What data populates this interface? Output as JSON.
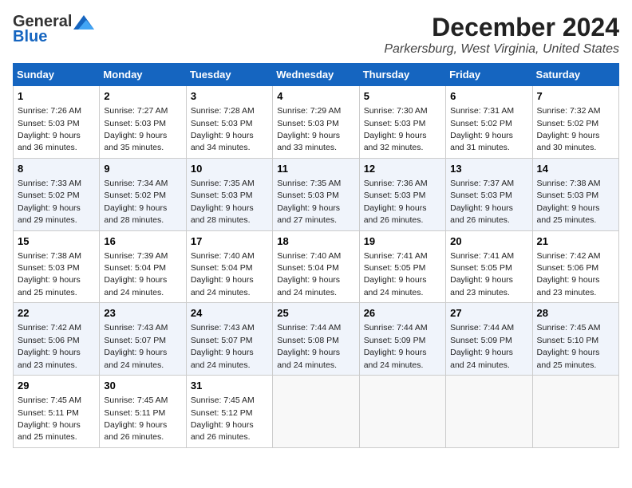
{
  "logo": {
    "general": "General",
    "blue": "Blue"
  },
  "title": "December 2024",
  "location": "Parkersburg, West Virginia, United States",
  "days_header": [
    "Sunday",
    "Monday",
    "Tuesday",
    "Wednesday",
    "Thursday",
    "Friday",
    "Saturday"
  ],
  "weeks": [
    [
      {
        "day": "1",
        "lines": [
          "Sunrise: 7:26 AM",
          "Sunset: 5:03 PM",
          "Daylight: 9 hours",
          "and 36 minutes."
        ]
      },
      {
        "day": "2",
        "lines": [
          "Sunrise: 7:27 AM",
          "Sunset: 5:03 PM",
          "Daylight: 9 hours",
          "and 35 minutes."
        ]
      },
      {
        "day": "3",
        "lines": [
          "Sunrise: 7:28 AM",
          "Sunset: 5:03 PM",
          "Daylight: 9 hours",
          "and 34 minutes."
        ]
      },
      {
        "day": "4",
        "lines": [
          "Sunrise: 7:29 AM",
          "Sunset: 5:03 PM",
          "Daylight: 9 hours",
          "and 33 minutes."
        ]
      },
      {
        "day": "5",
        "lines": [
          "Sunrise: 7:30 AM",
          "Sunset: 5:03 PM",
          "Daylight: 9 hours",
          "and 32 minutes."
        ]
      },
      {
        "day": "6",
        "lines": [
          "Sunrise: 7:31 AM",
          "Sunset: 5:02 PM",
          "Daylight: 9 hours",
          "and 31 minutes."
        ]
      },
      {
        "day": "7",
        "lines": [
          "Sunrise: 7:32 AM",
          "Sunset: 5:02 PM",
          "Daylight: 9 hours",
          "and 30 minutes."
        ]
      }
    ],
    [
      {
        "day": "8",
        "lines": [
          "Sunrise: 7:33 AM",
          "Sunset: 5:02 PM",
          "Daylight: 9 hours",
          "and 29 minutes."
        ]
      },
      {
        "day": "9",
        "lines": [
          "Sunrise: 7:34 AM",
          "Sunset: 5:02 PM",
          "Daylight: 9 hours",
          "and 28 minutes."
        ]
      },
      {
        "day": "10",
        "lines": [
          "Sunrise: 7:35 AM",
          "Sunset: 5:03 PM",
          "Daylight: 9 hours",
          "and 28 minutes."
        ]
      },
      {
        "day": "11",
        "lines": [
          "Sunrise: 7:35 AM",
          "Sunset: 5:03 PM",
          "Daylight: 9 hours",
          "and 27 minutes."
        ]
      },
      {
        "day": "12",
        "lines": [
          "Sunrise: 7:36 AM",
          "Sunset: 5:03 PM",
          "Daylight: 9 hours",
          "and 26 minutes."
        ]
      },
      {
        "day": "13",
        "lines": [
          "Sunrise: 7:37 AM",
          "Sunset: 5:03 PM",
          "Daylight: 9 hours",
          "and 26 minutes."
        ]
      },
      {
        "day": "14",
        "lines": [
          "Sunrise: 7:38 AM",
          "Sunset: 5:03 PM",
          "Daylight: 9 hours",
          "and 25 minutes."
        ]
      }
    ],
    [
      {
        "day": "15",
        "lines": [
          "Sunrise: 7:38 AM",
          "Sunset: 5:03 PM",
          "Daylight: 9 hours",
          "and 25 minutes."
        ]
      },
      {
        "day": "16",
        "lines": [
          "Sunrise: 7:39 AM",
          "Sunset: 5:04 PM",
          "Daylight: 9 hours",
          "and 24 minutes."
        ]
      },
      {
        "day": "17",
        "lines": [
          "Sunrise: 7:40 AM",
          "Sunset: 5:04 PM",
          "Daylight: 9 hours",
          "and 24 minutes."
        ]
      },
      {
        "day": "18",
        "lines": [
          "Sunrise: 7:40 AM",
          "Sunset: 5:04 PM",
          "Daylight: 9 hours",
          "and 24 minutes."
        ]
      },
      {
        "day": "19",
        "lines": [
          "Sunrise: 7:41 AM",
          "Sunset: 5:05 PM",
          "Daylight: 9 hours",
          "and 24 minutes."
        ]
      },
      {
        "day": "20",
        "lines": [
          "Sunrise: 7:41 AM",
          "Sunset: 5:05 PM",
          "Daylight: 9 hours",
          "and 23 minutes."
        ]
      },
      {
        "day": "21",
        "lines": [
          "Sunrise: 7:42 AM",
          "Sunset: 5:06 PM",
          "Daylight: 9 hours",
          "and 23 minutes."
        ]
      }
    ],
    [
      {
        "day": "22",
        "lines": [
          "Sunrise: 7:42 AM",
          "Sunset: 5:06 PM",
          "Daylight: 9 hours",
          "and 23 minutes."
        ]
      },
      {
        "day": "23",
        "lines": [
          "Sunrise: 7:43 AM",
          "Sunset: 5:07 PM",
          "Daylight: 9 hours",
          "and 24 minutes."
        ]
      },
      {
        "day": "24",
        "lines": [
          "Sunrise: 7:43 AM",
          "Sunset: 5:07 PM",
          "Daylight: 9 hours",
          "and 24 minutes."
        ]
      },
      {
        "day": "25",
        "lines": [
          "Sunrise: 7:44 AM",
          "Sunset: 5:08 PM",
          "Daylight: 9 hours",
          "and 24 minutes."
        ]
      },
      {
        "day": "26",
        "lines": [
          "Sunrise: 7:44 AM",
          "Sunset: 5:09 PM",
          "Daylight: 9 hours",
          "and 24 minutes."
        ]
      },
      {
        "day": "27",
        "lines": [
          "Sunrise: 7:44 AM",
          "Sunset: 5:09 PM",
          "Daylight: 9 hours",
          "and 24 minutes."
        ]
      },
      {
        "day": "28",
        "lines": [
          "Sunrise: 7:45 AM",
          "Sunset: 5:10 PM",
          "Daylight: 9 hours",
          "and 25 minutes."
        ]
      }
    ],
    [
      {
        "day": "29",
        "lines": [
          "Sunrise: 7:45 AM",
          "Sunset: 5:11 PM",
          "Daylight: 9 hours",
          "and 25 minutes."
        ]
      },
      {
        "day": "30",
        "lines": [
          "Sunrise: 7:45 AM",
          "Sunset: 5:11 PM",
          "Daylight: 9 hours",
          "and 26 minutes."
        ]
      },
      {
        "day": "31",
        "lines": [
          "Sunrise: 7:45 AM",
          "Sunset: 5:12 PM",
          "Daylight: 9 hours",
          "and 26 minutes."
        ]
      },
      null,
      null,
      null,
      null
    ]
  ]
}
